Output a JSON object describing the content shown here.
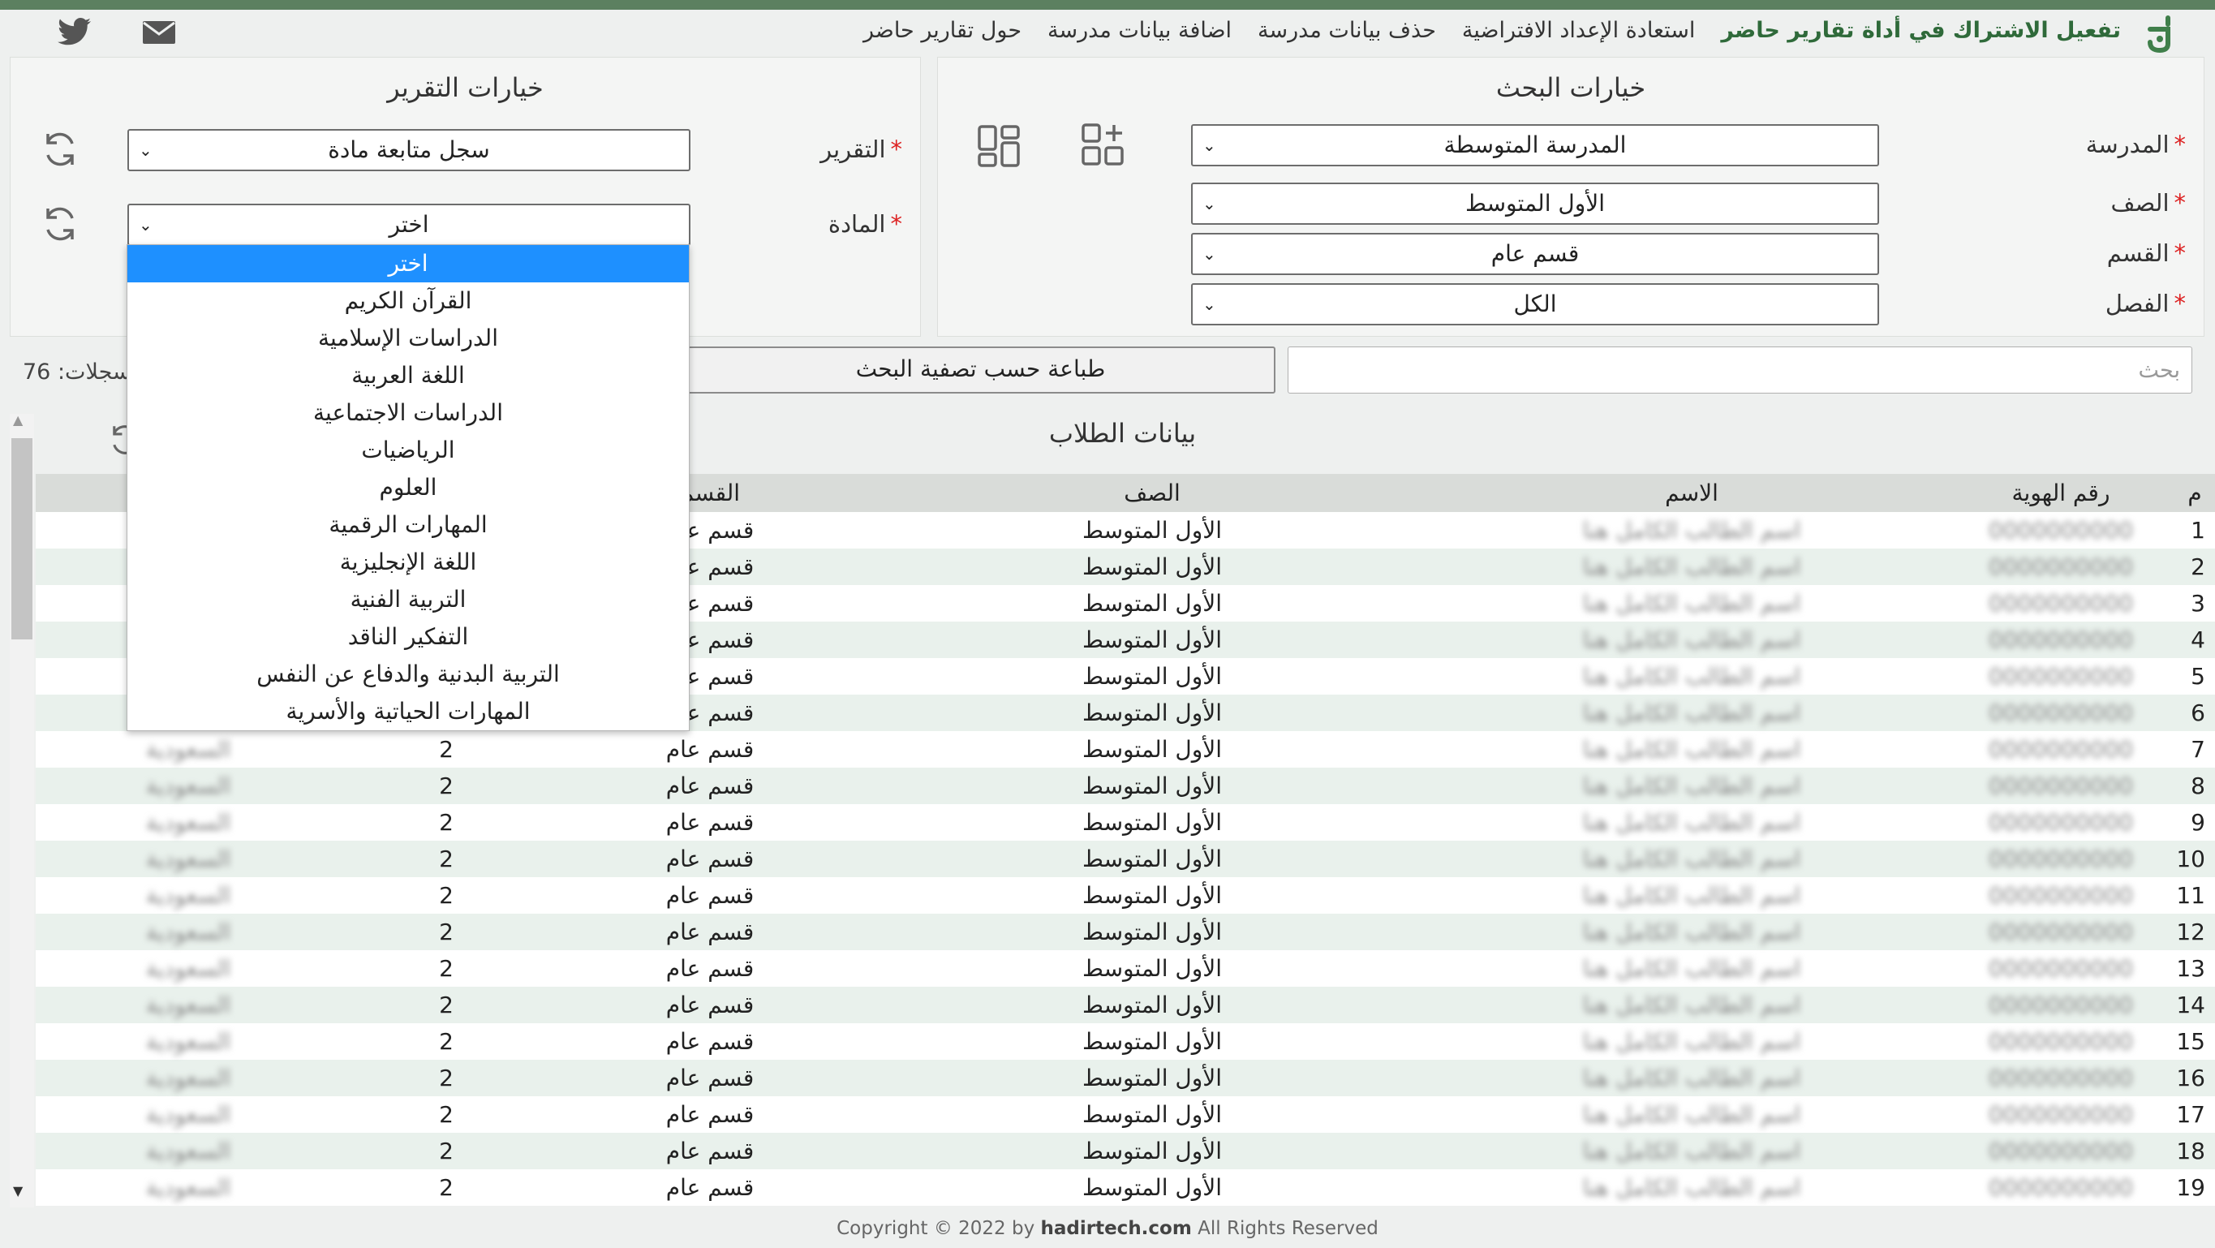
{
  "nav": {
    "links": [
      "حول تقارير حاضر",
      "اضافة بيانات مدرسة",
      "حذف بيانات مدرسة",
      "استعادة الإعداد الافتراضية",
      "تفعيل الاشتراك في أداة تقارير حاضر"
    ],
    "social": [
      "twitter-icon",
      "mail-icon"
    ],
    "accent": "#5c8060"
  },
  "search_options": {
    "title": "خيارات البحث",
    "school_label": "المدرسة",
    "school_value": "المدرسة المتوسطة",
    "grade_label": "الصف",
    "grade_value": "الأول المتوسط",
    "section_label": "القسم",
    "section_value": "قسم عام",
    "class_label": "الفصل",
    "class_value": "الكل"
  },
  "report_options": {
    "title": "خيارات التقرير",
    "report_label": "التقرير",
    "report_value": "سجل متابعة مادة",
    "subject_label": "المادة",
    "subject_value": "اختر",
    "subject_options": [
      "اختر",
      "القرآن الكريم",
      "الدراسات الإسلامية",
      "اللغة العربية",
      "الدراسات الاجتماعية",
      "الرياضيات",
      "العلوم",
      "المهارات الرقمية",
      "اللغة الإنجليزية",
      "التربية الفنية",
      "التفكير الناقد",
      "التربية البدنية والدفاع عن النفس",
      "المهارات الحياتية والأسرية"
    ]
  },
  "toolbar": {
    "search_placeholder": "بحث",
    "print_label": "طباعة حسب تصفية البحث",
    "records_text": "سجلات: 76"
  },
  "table": {
    "title": "بيانات الطلاب",
    "headers": [
      "م",
      "رقم الهوية",
      "الاسم",
      "الصف",
      "القسم",
      "",
      ""
    ],
    "grade": "الأول المتوسط",
    "section": "قسم عام",
    "class_no": "2",
    "row_numbers": [
      "1",
      "2",
      "3",
      "4",
      "5",
      "6",
      "7",
      "8",
      "9",
      "10",
      "11",
      "12",
      "13",
      "14",
      "15",
      "16",
      "17",
      "18",
      "19"
    ]
  },
  "footer": {
    "prefix": "Copyright © 2022 by",
    "site": "hadirtech.com",
    "suffix": "All Rights Reserved"
  }
}
